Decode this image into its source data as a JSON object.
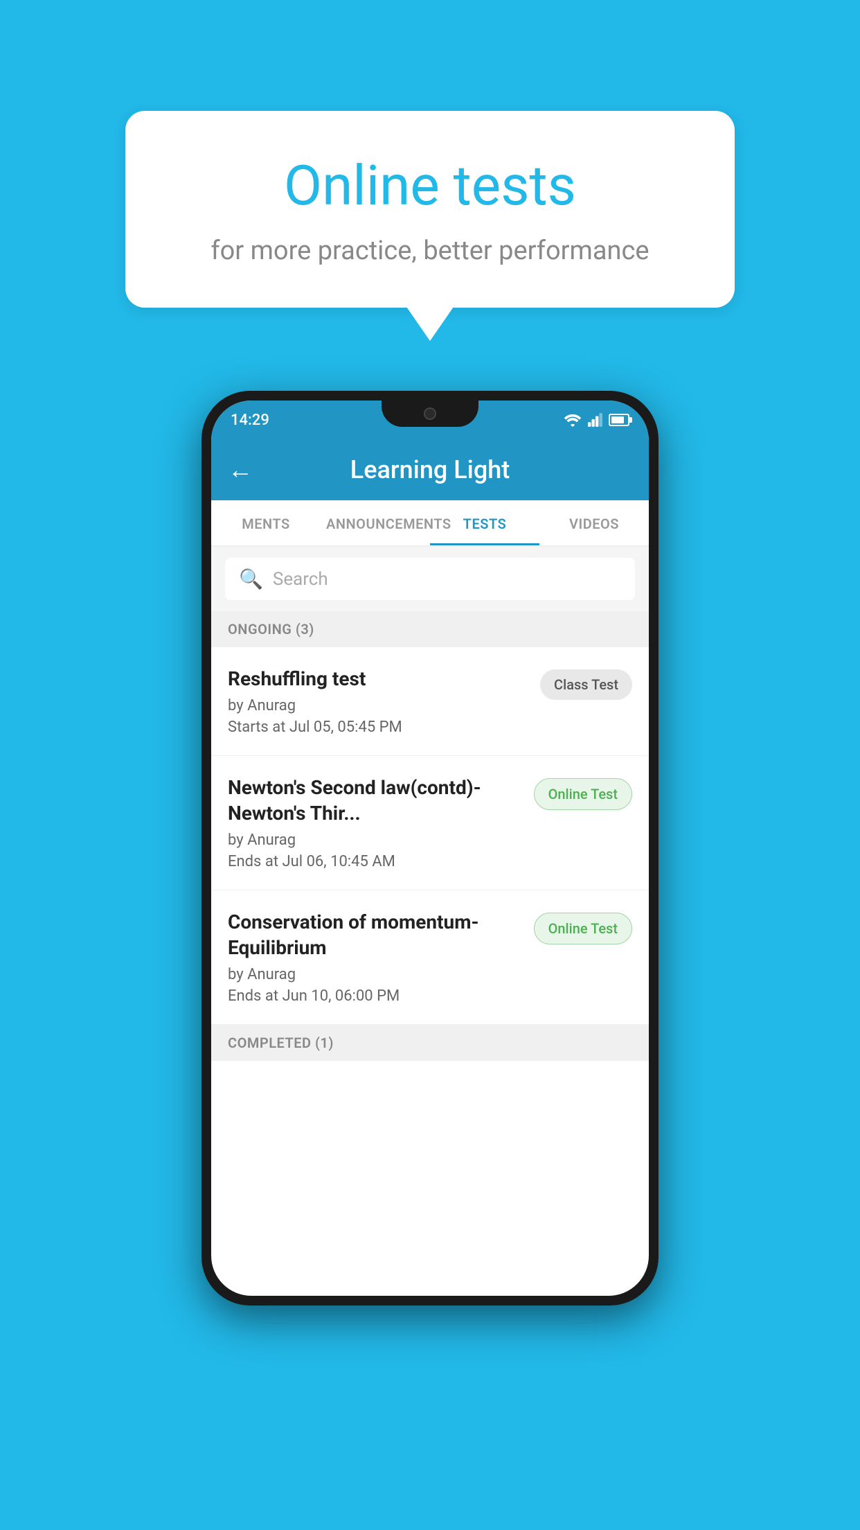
{
  "background_color": "#22B8E8",
  "bubble": {
    "title": "Online tests",
    "subtitle": "for more practice, better performance"
  },
  "phone": {
    "status_bar": {
      "time": "14:29",
      "icons": [
        "wifi",
        "signal",
        "battery"
      ]
    },
    "app_bar": {
      "title": "Learning Light",
      "back_label": "←"
    },
    "tabs": [
      {
        "label": "MENTS",
        "active": false
      },
      {
        "label": "ANNOUNCEMENTS",
        "active": false
      },
      {
        "label": "TESTS",
        "active": true
      },
      {
        "label": "VIDEOS",
        "active": false
      }
    ],
    "search": {
      "placeholder": "Search"
    },
    "ongoing_section": {
      "label": "ONGOING (3)",
      "tests": [
        {
          "name": "Reshuffling test",
          "author": "by Anurag",
          "date": "Starts at  Jul 05, 05:45 PM",
          "badge": "Class Test",
          "badge_type": "class"
        },
        {
          "name": "Newton's Second law(contd)-Newton's Thir...",
          "author": "by Anurag",
          "date": "Ends at  Jul 06, 10:45 AM",
          "badge": "Online Test",
          "badge_type": "online"
        },
        {
          "name": "Conservation of momentum-Equilibrium",
          "author": "by Anurag",
          "date": "Ends at  Jun 10, 06:00 PM",
          "badge": "Online Test",
          "badge_type": "online"
        }
      ]
    },
    "completed_section": {
      "label": "COMPLETED (1)"
    }
  }
}
